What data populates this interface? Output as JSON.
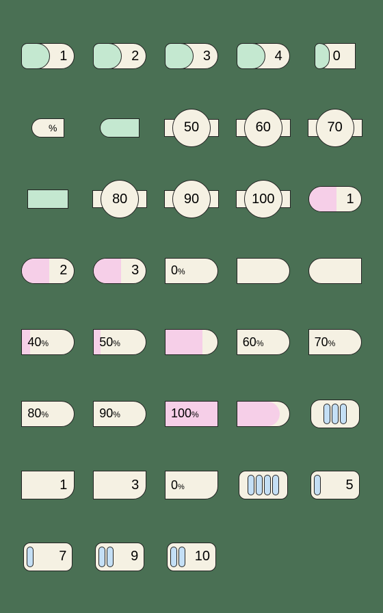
{
  "row1": {
    "c1": "1",
    "c2": "2",
    "c3": "3",
    "c4": "4",
    "c5": "0"
  },
  "row2": {
    "c1": "%",
    "c3": "50",
    "c4": "60",
    "c5": "70"
  },
  "row3": {
    "c2": "80",
    "c3": "90",
    "c4": "100",
    "c5": "1"
  },
  "row4": {
    "c1": "2",
    "c2": "3",
    "c3_num": "0",
    "c3_pct": "%"
  },
  "row5": {
    "c1_num": "40",
    "c2_num": "50",
    "c4_num": "60",
    "c5_num": "70",
    "pct": "%"
  },
  "row6": {
    "c1_num": "80",
    "c2_num": "90",
    "c3_num": "100",
    "pct": "%"
  },
  "row7": {
    "c1": "1",
    "c2": "3",
    "c3_num": "0",
    "c3_pct": "%",
    "c5": "5"
  },
  "row8": {
    "c1": "7",
    "c2": "9",
    "c3": "10"
  }
}
